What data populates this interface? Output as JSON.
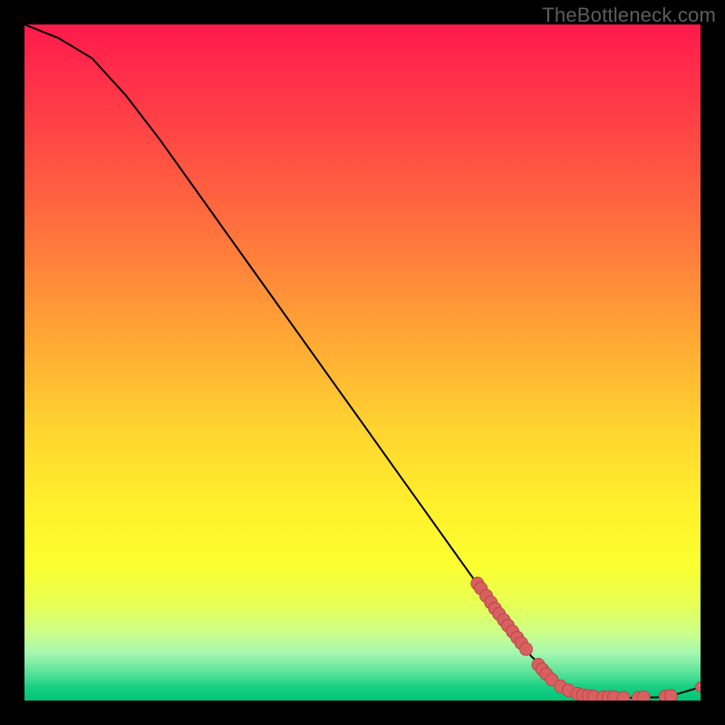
{
  "watermark": "TheBottleneck.com",
  "chart_data": {
    "type": "line",
    "title": "",
    "xlabel": "",
    "ylabel": "",
    "xlim": [
      0,
      100
    ],
    "ylim": [
      0,
      100
    ],
    "grid": false,
    "series": [
      {
        "name": "curve",
        "points": [
          {
            "x": 0,
            "y": 100
          },
          {
            "x": 5,
            "y": 98
          },
          {
            "x": 10,
            "y": 95
          },
          {
            "x": 15,
            "y": 89.5
          },
          {
            "x": 20,
            "y": 83
          },
          {
            "x": 25,
            "y": 76
          },
          {
            "x": 30,
            "y": 69
          },
          {
            "x": 35,
            "y": 62
          },
          {
            "x": 40,
            "y": 55
          },
          {
            "x": 45,
            "y": 48
          },
          {
            "x": 50,
            "y": 41
          },
          {
            "x": 55,
            "y": 34
          },
          {
            "x": 60,
            "y": 27
          },
          {
            "x": 65,
            "y": 20
          },
          {
            "x": 70,
            "y": 13
          },
          {
            "x": 75,
            "y": 6.5
          },
          {
            "x": 80,
            "y": 2
          },
          {
            "x": 85,
            "y": 0.6
          },
          {
            "x": 90,
            "y": 0.4
          },
          {
            "x": 95,
            "y": 0.5
          },
          {
            "x": 100,
            "y": 2
          }
        ]
      },
      {
        "name": "cluster-points",
        "points": [
          {
            "x": 67.0,
            "y": 17.3
          },
          {
            "x": 67.5,
            "y": 16.6
          },
          {
            "x": 68.3,
            "y": 15.5
          },
          {
            "x": 69.0,
            "y": 14.5
          },
          {
            "x": 69.6,
            "y": 13.6
          },
          {
            "x": 70.2,
            "y": 12.8
          },
          {
            "x": 70.9,
            "y": 11.9
          },
          {
            "x": 71.5,
            "y": 11.1
          },
          {
            "x": 72.2,
            "y": 10.2
          },
          {
            "x": 72.9,
            "y": 9.3
          },
          {
            "x": 73.5,
            "y": 8.5
          },
          {
            "x": 74.2,
            "y": 7.6
          },
          {
            "x": 76.0,
            "y": 5.3
          },
          {
            "x": 76.6,
            "y": 4.6
          },
          {
            "x": 77.2,
            "y": 3.9
          },
          {
            "x": 78.0,
            "y": 3.1
          },
          {
            "x": 79.3,
            "y": 2.1
          },
          {
            "x": 80.5,
            "y": 1.5
          },
          {
            "x": 81.8,
            "y": 1.0
          },
          {
            "x": 82.6,
            "y": 0.8
          },
          {
            "x": 83.4,
            "y": 0.7
          },
          {
            "x": 84.2,
            "y": 0.6
          },
          {
            "x": 85.6,
            "y": 0.5
          },
          {
            "x": 86.4,
            "y": 0.5
          },
          {
            "x": 87.2,
            "y": 0.5
          },
          {
            "x": 88.6,
            "y": 0.4
          },
          {
            "x": 90.8,
            "y": 0.4
          },
          {
            "x": 91.6,
            "y": 0.5
          },
          {
            "x": 94.8,
            "y": 0.6
          },
          {
            "x": 95.6,
            "y": 0.7
          },
          {
            "x": 100.0,
            "y": 2.0
          }
        ]
      }
    ]
  }
}
